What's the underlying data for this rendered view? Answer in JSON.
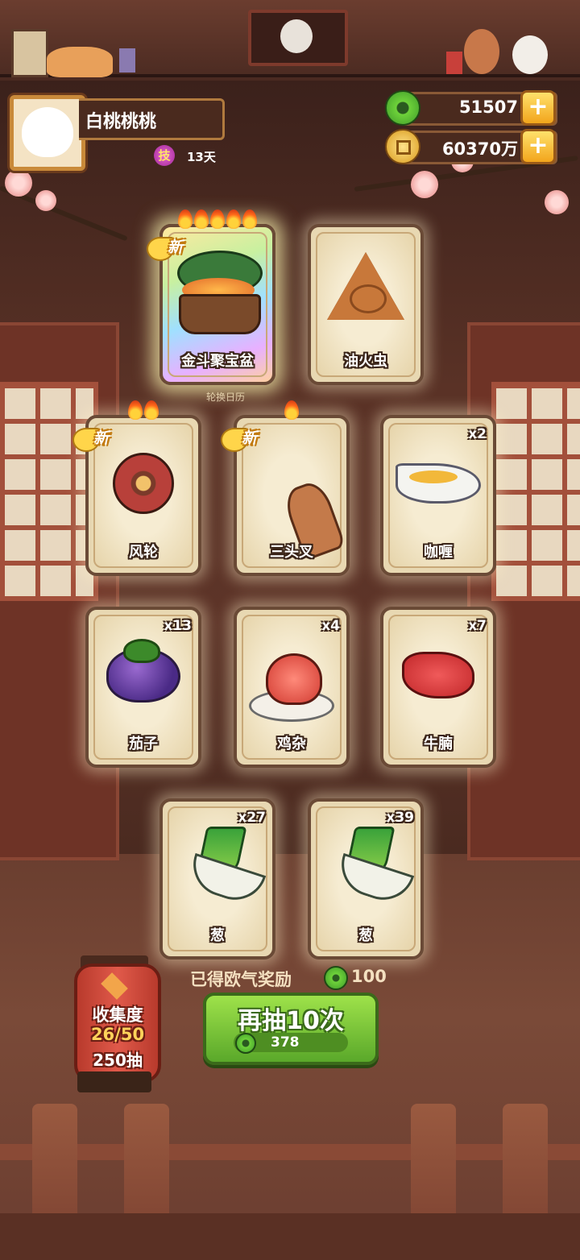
{
  "profile": {
    "name": "白桃桃桃",
    "skill_badge": "技",
    "days": "13天"
  },
  "currency": {
    "jade": "51507",
    "gold": "60370万",
    "plus": "+"
  },
  "calendar_label": "轮换日历",
  "cards": [
    {
      "name": "金斗聚宝盆",
      "count": "",
      "is_new": true,
      "flames": 5,
      "art": "treasure-bowl"
    },
    {
      "name": "油火虫",
      "count": "",
      "is_new": false,
      "flames": 0,
      "art": "triangle-cake"
    },
    {
      "name": "风轮",
      "count": "",
      "is_new": true,
      "flames": 2,
      "art": "wind-wheel"
    },
    {
      "name": "三头叉",
      "count": "",
      "is_new": true,
      "flames": 1,
      "art": "three-prong-fork"
    },
    {
      "name": "咖喱",
      "count": "x2",
      "is_new": false,
      "flames": 0,
      "art": "curry-gravy-boat"
    },
    {
      "name": "茄子",
      "count": "x13",
      "is_new": false,
      "flames": 0,
      "art": "eggplant"
    },
    {
      "name": "鸡杂",
      "count": "x4",
      "is_new": false,
      "flames": 0,
      "art": "chicken-giblets"
    },
    {
      "name": "牛腩",
      "count": "x7",
      "is_new": false,
      "flames": 0,
      "art": "beef-brisket"
    },
    {
      "name": "葱",
      "count": "x27",
      "is_new": false,
      "flames": 0,
      "art": "leek"
    },
    {
      "name": "葱",
      "count": "x39",
      "is_new": false,
      "flames": 0,
      "art": "leek"
    }
  ],
  "new_badge": "新",
  "reward": {
    "label": "已得欧气奖励",
    "value": "100"
  },
  "draw_button": {
    "label": "再抽10次",
    "cost": "378"
  },
  "collection": {
    "label": "收集度",
    "progress": "26/50",
    "draws": "250抽"
  },
  "colors": {
    "draw_button": "#7cc83a",
    "jade": "#6ed23a",
    "gold": "#f2a51c",
    "lantern": "#d24a3a"
  }
}
